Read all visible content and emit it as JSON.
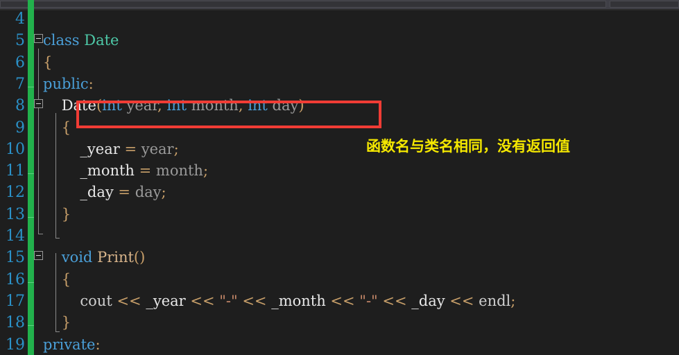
{
  "window": {
    "theme_background": "#1e1e1e",
    "gutter_number_color": "#2b91c8",
    "change_bar_color": "#22b14c",
    "highlight_box_color": "#f03c35",
    "annotation_color": "#f5e800"
  },
  "editor": {
    "first_visible_line": 4,
    "last_visible_line": 19,
    "lines": [
      {
        "number": "4",
        "tokens": []
      },
      {
        "number": "5",
        "tokens": [
          {
            "text": "class ",
            "cls": "kw"
          },
          {
            "text": "Date",
            "cls": "type"
          }
        ]
      },
      {
        "number": "6",
        "tokens": [
          {
            "text": "{",
            "cls": "punc"
          }
        ]
      },
      {
        "number": "7",
        "tokens": [
          {
            "text": "public",
            "cls": "kw"
          },
          {
            "text": ":",
            "cls": "punc"
          }
        ]
      },
      {
        "number": "8",
        "tokens": [
          {
            "text": "    ",
            "cls": "plain"
          },
          {
            "text": "Date",
            "cls": "mem"
          },
          {
            "text": "(",
            "cls": "punc"
          },
          {
            "text": "int",
            "cls": "kw"
          },
          {
            "text": " year",
            "cls": "param"
          },
          {
            "text": ",",
            "cls": "punc"
          },
          {
            "text": " int",
            "cls": "kw"
          },
          {
            "text": " month",
            "cls": "param"
          },
          {
            "text": ",",
            "cls": "punc"
          },
          {
            "text": " int",
            "cls": "kw"
          },
          {
            "text": " day",
            "cls": "param"
          },
          {
            "text": ")",
            "cls": "punc"
          }
        ]
      },
      {
        "number": "9",
        "tokens": [
          {
            "text": "    ",
            "cls": "plain"
          },
          {
            "text": "{",
            "cls": "punc"
          }
        ]
      },
      {
        "number": "10",
        "tokens": [
          {
            "text": "        ",
            "cls": "plain"
          },
          {
            "text": "_year",
            "cls": "mem"
          },
          {
            "text": " = ",
            "cls": "op"
          },
          {
            "text": "year",
            "cls": "param"
          },
          {
            "text": ";",
            "cls": "punc"
          }
        ]
      },
      {
        "number": "11",
        "tokens": [
          {
            "text": "        ",
            "cls": "plain"
          },
          {
            "text": "_month",
            "cls": "mem"
          },
          {
            "text": " = ",
            "cls": "op"
          },
          {
            "text": "month",
            "cls": "param"
          },
          {
            "text": ";",
            "cls": "punc"
          }
        ]
      },
      {
        "number": "12",
        "tokens": [
          {
            "text": "        ",
            "cls": "plain"
          },
          {
            "text": "_day",
            "cls": "mem"
          },
          {
            "text": " = ",
            "cls": "op"
          },
          {
            "text": "day",
            "cls": "param"
          },
          {
            "text": ";",
            "cls": "punc"
          }
        ]
      },
      {
        "number": "13",
        "tokens": [
          {
            "text": "    ",
            "cls": "plain"
          },
          {
            "text": "}",
            "cls": "punc"
          }
        ]
      },
      {
        "number": "14",
        "tokens": []
      },
      {
        "number": "15",
        "tokens": [
          {
            "text": "    ",
            "cls": "plain"
          },
          {
            "text": "void",
            "cls": "kw"
          },
          {
            "text": " ",
            "cls": "plain"
          },
          {
            "text": "Print",
            "cls": "fn"
          },
          {
            "text": "()",
            "cls": "punc"
          }
        ]
      },
      {
        "number": "16",
        "tokens": [
          {
            "text": "    ",
            "cls": "plain"
          },
          {
            "text": "{",
            "cls": "punc"
          }
        ]
      },
      {
        "number": "17",
        "tokens": [
          {
            "text": "        ",
            "cls": "plain"
          },
          {
            "text": "cout",
            "cls": "plain"
          },
          {
            "text": " << ",
            "cls": "op"
          },
          {
            "text": "_year",
            "cls": "mem"
          },
          {
            "text": " << ",
            "cls": "op"
          },
          {
            "text": "\"-\"",
            "cls": "str"
          },
          {
            "text": " << ",
            "cls": "op"
          },
          {
            "text": "_month",
            "cls": "mem"
          },
          {
            "text": " << ",
            "cls": "op"
          },
          {
            "text": "\"-\"",
            "cls": "str"
          },
          {
            "text": " << ",
            "cls": "op"
          },
          {
            "text": "_day",
            "cls": "mem"
          },
          {
            "text": " << ",
            "cls": "op"
          },
          {
            "text": "endl",
            "cls": "plain"
          },
          {
            "text": ";",
            "cls": "punc"
          }
        ]
      },
      {
        "number": "18",
        "tokens": [
          {
            "text": "    ",
            "cls": "plain"
          },
          {
            "text": "}",
            "cls": "punc"
          }
        ]
      },
      {
        "number": "19",
        "tokens": [
          {
            "text": "private",
            "cls": "kw"
          },
          {
            "text": ":",
            "cls": "punc"
          }
        ]
      }
    ],
    "fold_markers": [
      {
        "line": "5",
        "state": "expanded"
      },
      {
        "line": "8",
        "state": "expanded"
      },
      {
        "line": "15",
        "state": "expanded"
      }
    ]
  },
  "annotations": {
    "highlight_box": {
      "label": "constructor-signature-highlight",
      "target_line": "8"
    },
    "note": {
      "text": "函数名与类名相同，没有返回值"
    }
  }
}
